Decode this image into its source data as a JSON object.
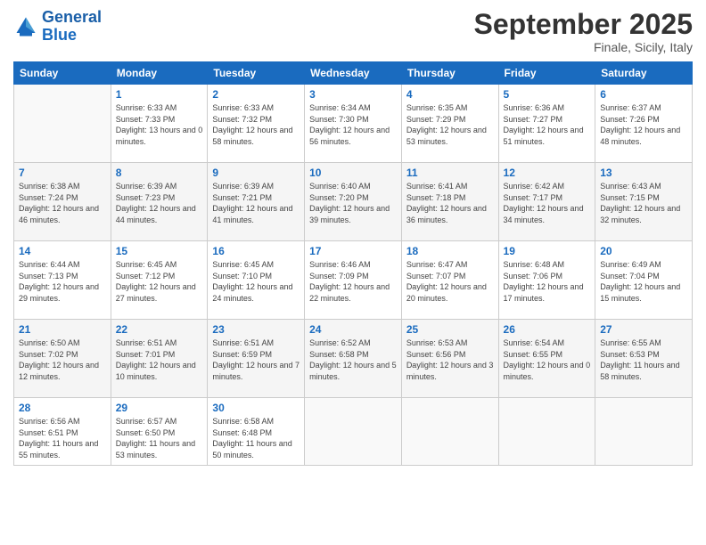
{
  "logo": {
    "line1": "General",
    "line2": "Blue"
  },
  "title": "September 2025",
  "location": "Finale, Sicily, Italy",
  "days_of_week": [
    "Sunday",
    "Monday",
    "Tuesday",
    "Wednesday",
    "Thursday",
    "Friday",
    "Saturday"
  ],
  "weeks": [
    [
      {
        "day": null
      },
      {
        "day": 1,
        "sunrise": "6:33 AM",
        "sunset": "7:33 PM",
        "daylight": "13 hours and 0 minutes."
      },
      {
        "day": 2,
        "sunrise": "6:33 AM",
        "sunset": "7:32 PM",
        "daylight": "12 hours and 58 minutes."
      },
      {
        "day": 3,
        "sunrise": "6:34 AM",
        "sunset": "7:30 PM",
        "daylight": "12 hours and 56 minutes."
      },
      {
        "day": 4,
        "sunrise": "6:35 AM",
        "sunset": "7:29 PM",
        "daylight": "12 hours and 53 minutes."
      },
      {
        "day": 5,
        "sunrise": "6:36 AM",
        "sunset": "7:27 PM",
        "daylight": "12 hours and 51 minutes."
      },
      {
        "day": 6,
        "sunrise": "6:37 AM",
        "sunset": "7:26 PM",
        "daylight": "12 hours and 48 minutes."
      }
    ],
    [
      {
        "day": 7,
        "sunrise": "6:38 AM",
        "sunset": "7:24 PM",
        "daylight": "12 hours and 46 minutes."
      },
      {
        "day": 8,
        "sunrise": "6:39 AM",
        "sunset": "7:23 PM",
        "daylight": "12 hours and 44 minutes."
      },
      {
        "day": 9,
        "sunrise": "6:39 AM",
        "sunset": "7:21 PM",
        "daylight": "12 hours and 41 minutes."
      },
      {
        "day": 10,
        "sunrise": "6:40 AM",
        "sunset": "7:20 PM",
        "daylight": "12 hours and 39 minutes."
      },
      {
        "day": 11,
        "sunrise": "6:41 AM",
        "sunset": "7:18 PM",
        "daylight": "12 hours and 36 minutes."
      },
      {
        "day": 12,
        "sunrise": "6:42 AM",
        "sunset": "7:17 PM",
        "daylight": "12 hours and 34 minutes."
      },
      {
        "day": 13,
        "sunrise": "6:43 AM",
        "sunset": "7:15 PM",
        "daylight": "12 hours and 32 minutes."
      }
    ],
    [
      {
        "day": 14,
        "sunrise": "6:44 AM",
        "sunset": "7:13 PM",
        "daylight": "12 hours and 29 minutes."
      },
      {
        "day": 15,
        "sunrise": "6:45 AM",
        "sunset": "7:12 PM",
        "daylight": "12 hours and 27 minutes."
      },
      {
        "day": 16,
        "sunrise": "6:45 AM",
        "sunset": "7:10 PM",
        "daylight": "12 hours and 24 minutes."
      },
      {
        "day": 17,
        "sunrise": "6:46 AM",
        "sunset": "7:09 PM",
        "daylight": "12 hours and 22 minutes."
      },
      {
        "day": 18,
        "sunrise": "6:47 AM",
        "sunset": "7:07 PM",
        "daylight": "12 hours and 20 minutes."
      },
      {
        "day": 19,
        "sunrise": "6:48 AM",
        "sunset": "7:06 PM",
        "daylight": "12 hours and 17 minutes."
      },
      {
        "day": 20,
        "sunrise": "6:49 AM",
        "sunset": "7:04 PM",
        "daylight": "12 hours and 15 minutes."
      }
    ],
    [
      {
        "day": 21,
        "sunrise": "6:50 AM",
        "sunset": "7:02 PM",
        "daylight": "12 hours and 12 minutes."
      },
      {
        "day": 22,
        "sunrise": "6:51 AM",
        "sunset": "7:01 PM",
        "daylight": "12 hours and 10 minutes."
      },
      {
        "day": 23,
        "sunrise": "6:51 AM",
        "sunset": "6:59 PM",
        "daylight": "12 hours and 7 minutes."
      },
      {
        "day": 24,
        "sunrise": "6:52 AM",
        "sunset": "6:58 PM",
        "daylight": "12 hours and 5 minutes."
      },
      {
        "day": 25,
        "sunrise": "6:53 AM",
        "sunset": "6:56 PM",
        "daylight": "12 hours and 3 minutes."
      },
      {
        "day": 26,
        "sunrise": "6:54 AM",
        "sunset": "6:55 PM",
        "daylight": "12 hours and 0 minutes."
      },
      {
        "day": 27,
        "sunrise": "6:55 AM",
        "sunset": "6:53 PM",
        "daylight": "11 hours and 58 minutes."
      }
    ],
    [
      {
        "day": 28,
        "sunrise": "6:56 AM",
        "sunset": "6:51 PM",
        "daylight": "11 hours and 55 minutes."
      },
      {
        "day": 29,
        "sunrise": "6:57 AM",
        "sunset": "6:50 PM",
        "daylight": "11 hours and 53 minutes."
      },
      {
        "day": 30,
        "sunrise": "6:58 AM",
        "sunset": "6:48 PM",
        "daylight": "11 hours and 50 minutes."
      },
      {
        "day": null
      },
      {
        "day": null
      },
      {
        "day": null
      },
      {
        "day": null
      }
    ]
  ]
}
